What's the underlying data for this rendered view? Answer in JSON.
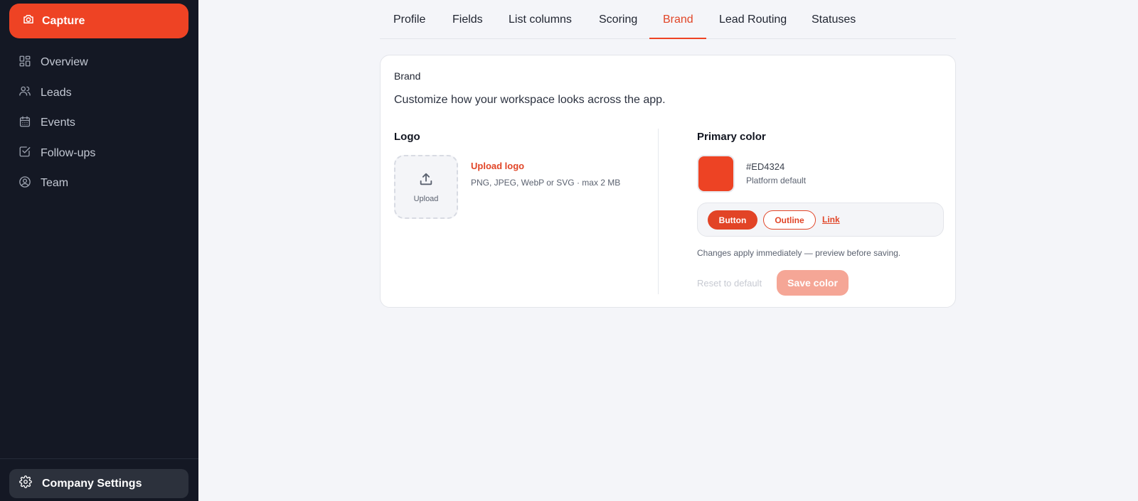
{
  "sidebar": {
    "brand_label": "Capture",
    "items": [
      {
        "label": "Overview",
        "icon": "grid-icon"
      },
      {
        "label": "Leads",
        "icon": "users-icon"
      },
      {
        "label": "Events",
        "icon": "calendar-icon"
      },
      {
        "label": "Follow-ups",
        "icon": "check-square-icon"
      },
      {
        "label": "Team",
        "icon": "user-circle-icon"
      }
    ],
    "settings_label": "Company Settings"
  },
  "tabs": [
    {
      "label": "Profile"
    },
    {
      "label": "Fields"
    },
    {
      "label": "List columns"
    },
    {
      "label": "Scoring"
    },
    {
      "label": "Brand",
      "active": true
    },
    {
      "label": "Lead Routing"
    },
    {
      "label": "Statuses"
    }
  ],
  "card": {
    "title": "Brand",
    "description": "Customize how your workspace looks across the app.",
    "logo": {
      "heading": "Logo",
      "upload_box_label": "Upload",
      "upload_link": "Upload logo",
      "hint": "PNG, JPEG, WebP or SVG · max 2 MB"
    },
    "primary_color": {
      "heading": "Primary color",
      "hex": "#ED4324",
      "subtitle": "Platform default",
      "preview_button": "Button",
      "preview_outline": "Outline",
      "preview_link": "Link",
      "hint": "Changes apply immediately — preview before saving.",
      "reset_label": "Reset to default",
      "save_label": "Save color"
    }
  },
  "colors": {
    "accent": "#ED4324",
    "sidebar_bg": "#141824",
    "page_bg": "#F4F5F9"
  }
}
